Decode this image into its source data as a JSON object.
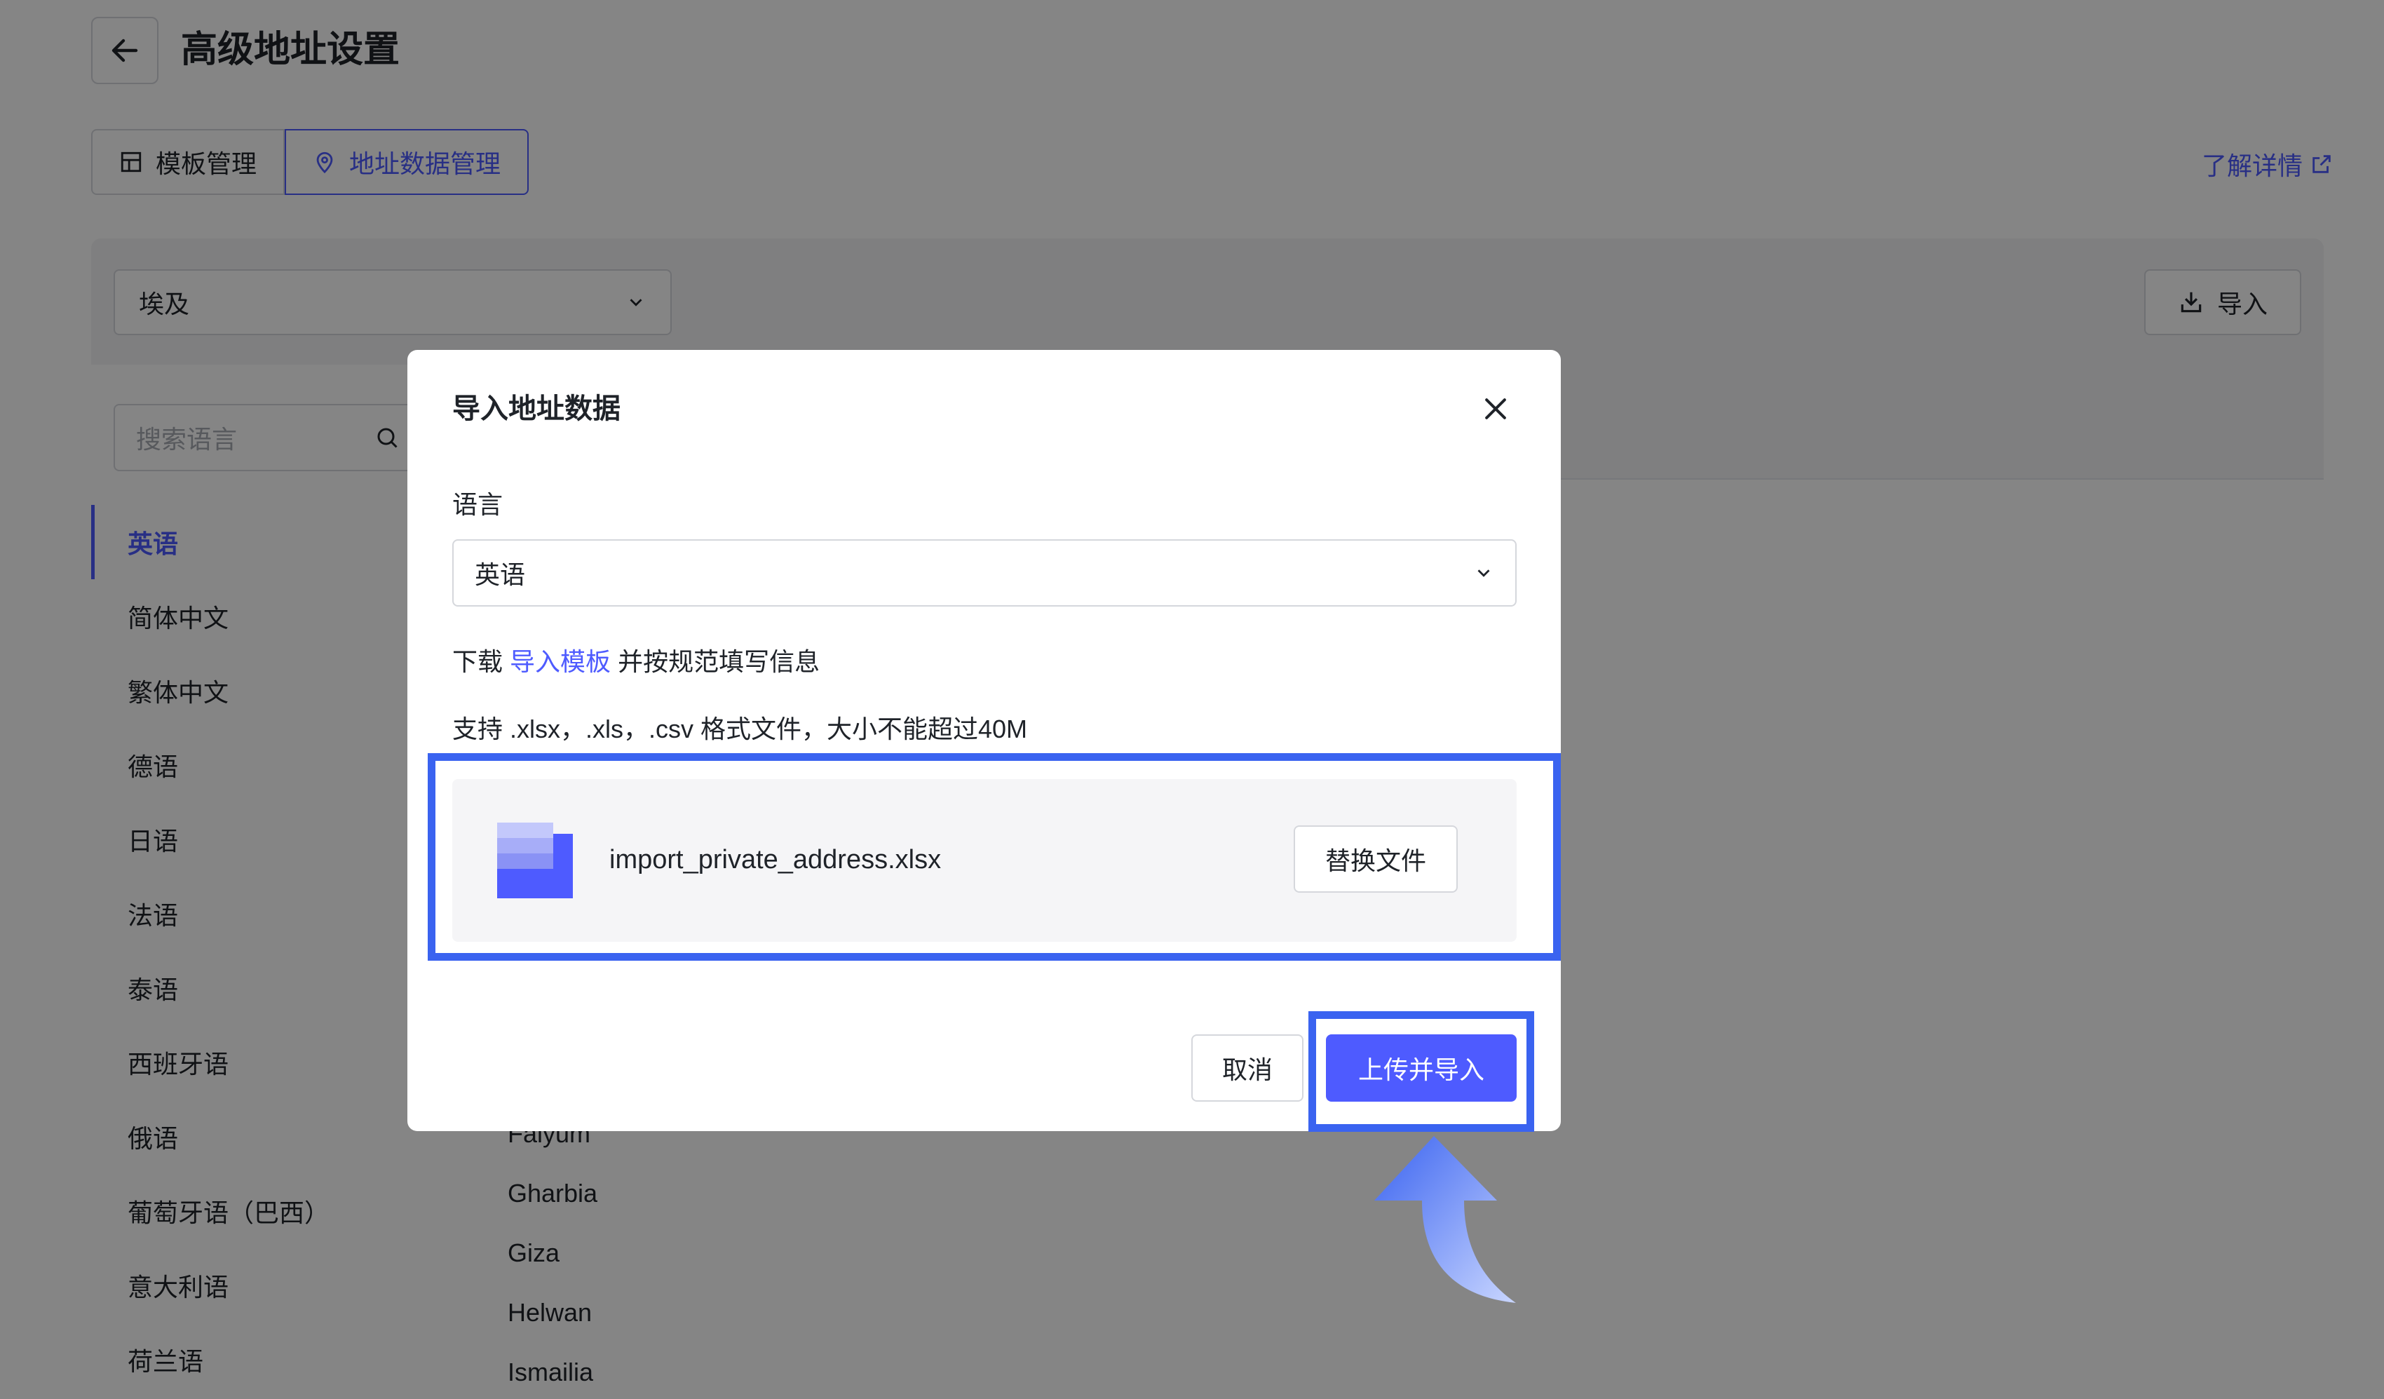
{
  "header": {
    "title": "高级地址设置",
    "back_icon": "arrow-left-icon"
  },
  "tabs": [
    {
      "label": "模板管理",
      "icon": "template-icon",
      "active": false
    },
    {
      "label": "地址数据管理",
      "icon": "location-pin-icon",
      "active": true
    }
  ],
  "learn_more": {
    "label": "了解详情",
    "icon": "external-link-icon"
  },
  "country_select": {
    "value": "埃及"
  },
  "import_button": {
    "label": "导入",
    "icon": "download-icon"
  },
  "search": {
    "placeholder": "搜索语言"
  },
  "languages": [
    {
      "label": "英语",
      "active": true
    },
    {
      "label": "简体中文"
    },
    {
      "label": "繁体中文"
    },
    {
      "label": "德语"
    },
    {
      "label": "日语"
    },
    {
      "label": "法语"
    },
    {
      "label": "泰语"
    },
    {
      "label": "西班牙语"
    },
    {
      "label": "俄语"
    },
    {
      "label": "葡萄牙语（巴西）"
    },
    {
      "label": "意大利语"
    },
    {
      "label": "荷兰语"
    }
  ],
  "regions": [
    "Faiyum",
    "Gharbia",
    "Giza",
    "Helwan",
    "Ismailia"
  ],
  "modal": {
    "title": "导入地址数据",
    "language_label": "语言",
    "language_value": "英语",
    "download_prefix": "下载",
    "download_link": "导入模板",
    "download_suffix": "并按规范填写信息",
    "support_text": "支持 .xlsx，.xls，.csv 格式文件，大小不能超过40M",
    "file_name": "import_private_address.xlsx",
    "replace_label": "替换文件",
    "cancel_label": "取消",
    "upload_label": "上传并导入"
  },
  "colors": {
    "accent": "#4e5bff",
    "highlight": "#3a63f0",
    "overlay": "rgba(0,0,0,0.48)"
  }
}
